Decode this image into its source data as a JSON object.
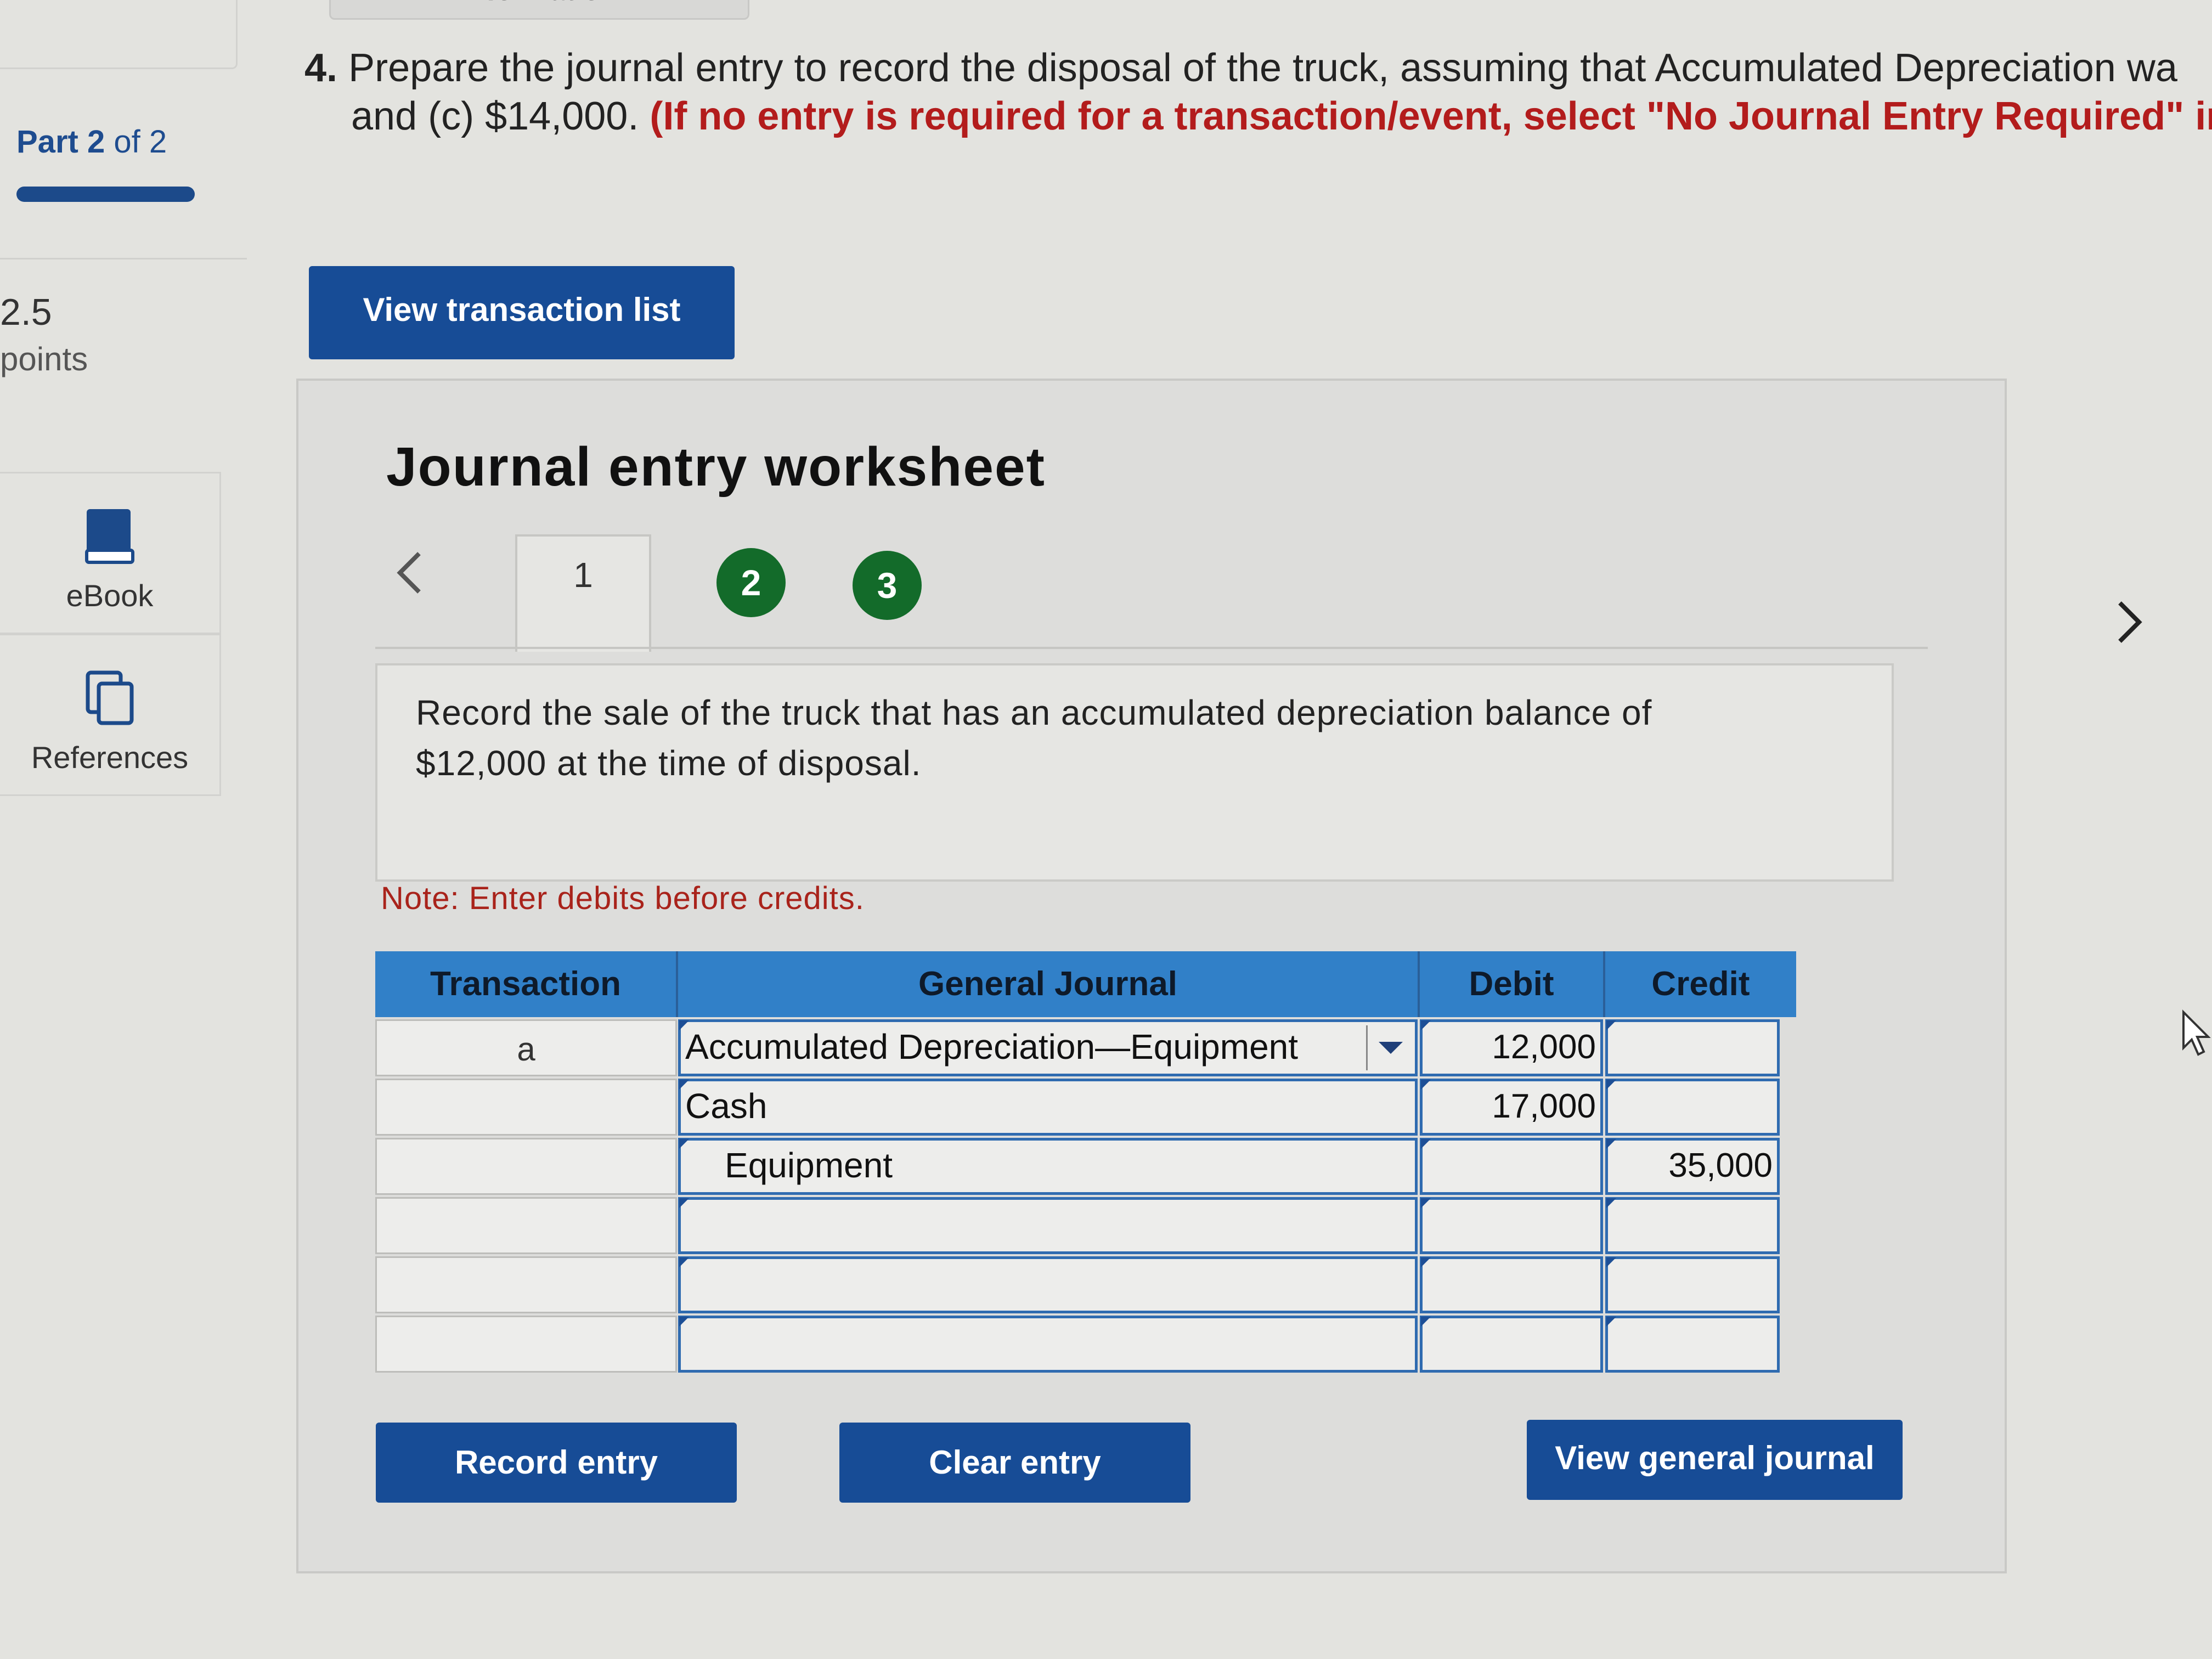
{
  "top_tab": {
    "label": "Information"
  },
  "sidebar": {
    "part_label": "Part",
    "part_current": "2",
    "part_of": "of 2",
    "points_value": "2.5",
    "points_label": "points",
    "ebook_label": "eBook",
    "references_label": "References"
  },
  "question": {
    "number": "4.",
    "line1": "Prepare the journal entry to record the disposal of the truck, assuming that Accumulated Depreciation wa",
    "line2_prefix": "and (c) $14,000.",
    "line2_red": "(If no entry is required for a transaction/event, select \"No Journal Entry Required\" in th"
  },
  "buttons": {
    "view_transaction_list": "View transaction list",
    "record_entry": "Record entry",
    "clear_entry": "Clear entry",
    "view_general_journal": "View general journal"
  },
  "worksheet": {
    "title": "Journal entry worksheet",
    "tabs": [
      "1",
      "2",
      "3"
    ],
    "instruction": "Record the sale of the truck that has an accumulated depreciation balance of $12,000 at the time of disposal.",
    "note": "Note: Enter debits before credits."
  },
  "table": {
    "headers": [
      "Transaction",
      "General Journal",
      "Debit",
      "Credit"
    ],
    "rows": [
      {
        "transaction": "a",
        "account": "Accumulated Depreciation—Equipment",
        "debit": "12,000",
        "credit": ""
      },
      {
        "transaction": "",
        "account": "Cash",
        "debit": "17,000",
        "credit": ""
      },
      {
        "transaction": "",
        "account": "Equipment",
        "debit": "",
        "credit": "35,000"
      },
      {
        "transaction": "",
        "account": "",
        "debit": "",
        "credit": ""
      },
      {
        "transaction": "",
        "account": "",
        "debit": "",
        "credit": ""
      },
      {
        "transaction": "",
        "account": "",
        "debit": "",
        "credit": ""
      }
    ]
  },
  "colors": {
    "primary_button": "#174c96",
    "table_header": "#3180c8",
    "tab_circle": "#136b2a",
    "note_red": "#a9231b"
  }
}
